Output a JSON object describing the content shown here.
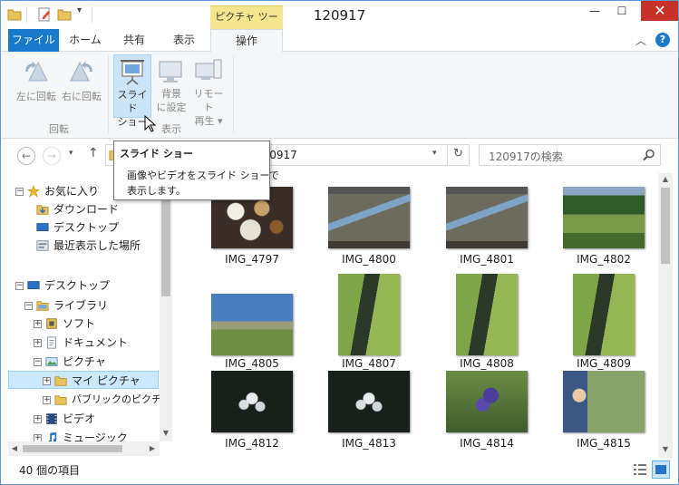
{
  "window": {
    "title": "120917",
    "contextual_tab": "ピクチャ ツール",
    "controls": {
      "minimize": "—",
      "maximize": "☐",
      "close": "✕"
    }
  },
  "ribbon_tabs": [
    "ファイル",
    "ホーム",
    "共有",
    "表示",
    "操作"
  ],
  "ribbon": {
    "rotate_group": {
      "label": "回転",
      "rotate_left": "左に回転",
      "rotate_right": "右に回転"
    },
    "view_group": {
      "label": "表示",
      "slideshow": [
        "スライド",
        "ショー"
      ],
      "set_background": [
        "背景",
        "に設定"
      ],
      "remote_play": [
        "リモート",
        "再生 ▾"
      ]
    }
  },
  "address": {
    "current": "120917",
    "search_placeholder": "120917の検索"
  },
  "tooltip": {
    "title": "スライド ショー",
    "body_line1": "画像やビデオをスライド ショーで",
    "body_line2": "表示します。"
  },
  "nav": {
    "favorites": "お気に入り",
    "downloads": "ダウンロード",
    "desktop_fav": "デスクトップ",
    "recent": "最近表示した場所",
    "desktop": "デスクトップ",
    "libraries": "ライブラリ",
    "software": "ソフト",
    "documents": "ドキュメント",
    "pictures": "ピクチャ",
    "my_pictures": "マイ ピクチャ",
    "public_pictures": "パブリックのピクチャ",
    "videos": "ビデオ",
    "music": "ミュージック"
  },
  "files": [
    {
      "name": "IMG_4797",
      "kind": "food"
    },
    {
      "name": "IMG_4800",
      "kind": "board"
    },
    {
      "name": "IMG_4801",
      "kind": "board"
    },
    {
      "name": "IMG_4802",
      "kind": "marsh"
    },
    {
      "name": "IMG_4805",
      "kind": "field"
    },
    {
      "name": "IMG_4807",
      "kind": "stream"
    },
    {
      "name": "IMG_4808",
      "kind": "stream"
    },
    {
      "name": "IMG_4809",
      "kind": "stream"
    },
    {
      "name": "IMG_4812",
      "kind": "flowers-dark"
    },
    {
      "name": "IMG_4813",
      "kind": "flowers-dark"
    },
    {
      "name": "IMG_4814",
      "kind": "gentian"
    },
    {
      "name": "IMG_4815",
      "kind": "person"
    }
  ],
  "status": {
    "item_count": "40 個の項目"
  },
  "colors": {
    "accent": "#1979ca",
    "contextual": "#f5e58f",
    "selection": "#cce8ff",
    "close": "#c7312a"
  }
}
